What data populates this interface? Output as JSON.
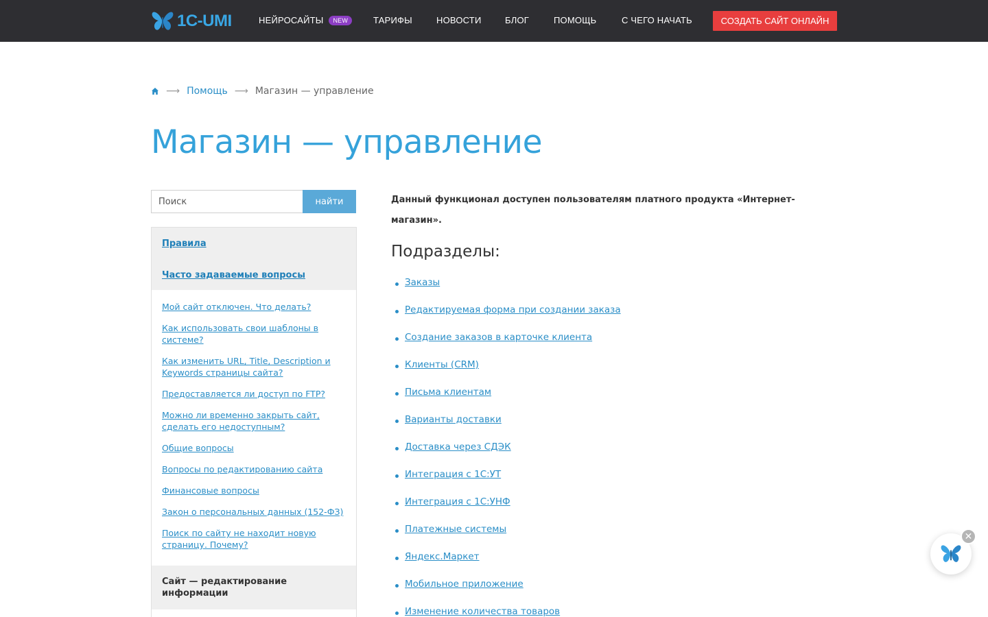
{
  "header": {
    "logo_text": "1C-UMI",
    "nav": [
      {
        "label": "Нейросайты",
        "badge": "NEW"
      },
      {
        "label": "Тарифы"
      },
      {
        "label": "Новости"
      },
      {
        "label": "Блог"
      },
      {
        "label": "Помощь"
      },
      {
        "label": "С чего начать"
      }
    ],
    "cta_label": "Создать сайт онлайн"
  },
  "breadcrumb": {
    "home_icon": "home-icon",
    "items": [
      "Помощь",
      "Магазин — управление"
    ],
    "separator": "⟶"
  },
  "page_title": "Магазин — управление",
  "search": {
    "placeholder": "Поиск",
    "button_label": "найти"
  },
  "sidebar": {
    "head_links": [
      "Правила",
      "Часто задаваемые вопросы"
    ],
    "items": [
      "Мой сайт отключен. Что делать?",
      "Как использовать свои шаблоны в системе?",
      "Как изменить URL, Title, Description и Keywords страницы сайта?",
      "Предоставляется ли доступ по FTP?",
      "Можно ли временно закрыть сайт, сделать его недоступным?",
      "Общие вопросы",
      "Вопросы по редактированию сайта",
      "Финансовые вопросы",
      "Закон о персональных данных (152-ФЗ)",
      "Поиск по сайту не находит новую страницу. Почему?"
    ],
    "foot_title": "Сайт — редактирование информации"
  },
  "main": {
    "notice": "Данный функционал доступен пользователям платного продукта «Интернет-магазин».",
    "subhead": "Подразделы:",
    "links": [
      "Заказы",
      "Редактируемая форма при создании заказа",
      "Создание заказов в карточке клиента",
      "Клиенты (CRM)",
      "Письма клиентам",
      "Варианты доставки",
      "Доставка через СДЭК",
      "Интеграция с 1С:УТ",
      "Интеграция с 1С:УНФ",
      "Платежные системы",
      "Яндекс.Маркет",
      "Мобильное приложение",
      "Изменение количества товаров"
    ]
  },
  "chat_widget": {
    "icon": "butterfly-icon",
    "close_glyph": "✕"
  },
  "colors": {
    "header_bg": "#2e2e32",
    "accent_blue": "#35a2da",
    "link_blue": "#2a8ec7",
    "cta_red": "#e83e3e",
    "badge_purple": "#8c3ec4"
  }
}
